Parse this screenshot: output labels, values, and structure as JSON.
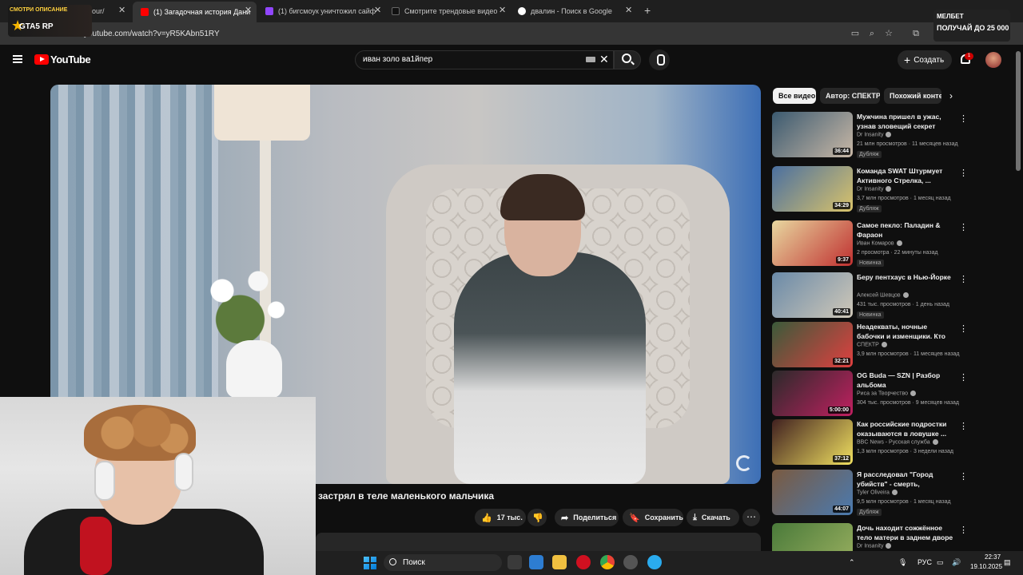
{
  "browser": {
    "tabs": [
      {
        "label": "СМОТРИ ОПИСАНИЕ",
        "partial": "our/"
      },
      {
        "label": "(1) Загадочная история Дани"
      },
      {
        "label": "(1) бигсмоук уничтожил сайф"
      },
      {
        "label": "Смотрите трендовые видео |"
      },
      {
        "label": "двалин - Поиск в Google"
      }
    ],
    "url": "youtube.com/watch?v=yR5KAbn51RY",
    "ad_left_logo": "GTA5 RP",
    "ad_right_line1": "МЕЛБЕТ",
    "ad_right_line2": "ПОЛУЧАЙ ДО 25 000"
  },
  "header": {
    "logo_text": "YouTube",
    "search_value": "иван золо ва1йпер",
    "create_label": "Создать",
    "notif_count": "1"
  },
  "video": {
    "title": "застрял в теле маленького мальчика",
    "likes": "17 тыс.",
    "share_label": "Поделиться",
    "save_label": "Сохранить",
    "download_label": "Скачать"
  },
  "chips": [
    "Все видео",
    "Автор: СПЕКТР",
    "Похожий конте"
  ],
  "recommendations": [
    {
      "title": "Мужчина пришел в ужас, узнав зловещий секрет свое...",
      "channel": "Dr Insanity",
      "meta": "21 млн просмотров · 11 месяцев назад",
      "badge": "Дубляж",
      "duration": "36:44",
      "colors": [
        "#3b5a70",
        "#c9b8a6"
      ]
    },
    {
      "title": "Команда SWAT Штурмует Активного Стрелка, ...",
      "channel": "Dr Insanity",
      "meta": "3,7 млн просмотров · 1 месяц назад",
      "badge": "Дубляж",
      "duration": "34:29",
      "colors": [
        "#4a6fa0",
        "#d9c36a"
      ]
    },
    {
      "title": "Самое пекло: Паладин & Фараон",
      "channel": "Иван Комаров",
      "meta": "2 просмотра · 22 минуты назад",
      "badge": "Новинка",
      "duration": "9:37",
      "colors": [
        "#e8d8a0",
        "#c03030"
      ]
    },
    {
      "title": "Беру пентхаус в Нью-Йорке",
      "channel": "Алексей Шевцов",
      "meta": "431 тыс. просмотров · 1 день назад",
      "badge": "Новинка",
      "duration": "40:41",
      "colors": [
        "#6a8aa8",
        "#d0c8b8"
      ]
    },
    {
      "title": "Неадекваты, ночные бабочки и изменщики. Кто катается ...",
      "channel": "СПЕКТР",
      "meta": "3,9 млн просмотров · 11 месяцев назад",
      "badge": "",
      "duration": "32:21",
      "colors": [
        "#3a5a3a",
        "#e04040"
      ]
    },
    {
      "title": "OG Buda — SZN | Разбор альбома",
      "channel": "Риса за Творчество",
      "meta": "304 тыс. просмотров · 9 месяцев назад",
      "badge": "",
      "duration": "5:00:00",
      "colors": [
        "#2a2a2a",
        "#c02060"
      ]
    },
    {
      "title": "Как российские подростки оказываются в ловушке ...",
      "channel": "BBC News - Русская служба",
      "meta": "1,3 млн просмотров · 3 недели назад",
      "badge": "",
      "duration": "37:12",
      "colors": [
        "#402020",
        "#f0e060"
      ]
    },
    {
      "title": "Я расследовал \"Город убийств\" - смерть, наркотик...",
      "channel": "Tyler Oliveira",
      "meta": "9,5 млн просмотров · 1 месяц назад",
      "badge": "Дубляж",
      "duration": "44:07",
      "colors": [
        "#7a5a40",
        "#4a7ab0"
      ]
    },
    {
      "title": "Дочь находит сожжённое тело матери в заднем дворе",
      "channel": "Dr Insanity",
      "meta": "",
      "badge": "",
      "duration": "",
      "colors": [
        "#4a7a3a",
        "#9ab060"
      ]
    }
  ],
  "taskbar": {
    "search_placeholder": "Поиск",
    "lang": "РУС",
    "time": "22:37",
    "date": "19.10.2025"
  }
}
